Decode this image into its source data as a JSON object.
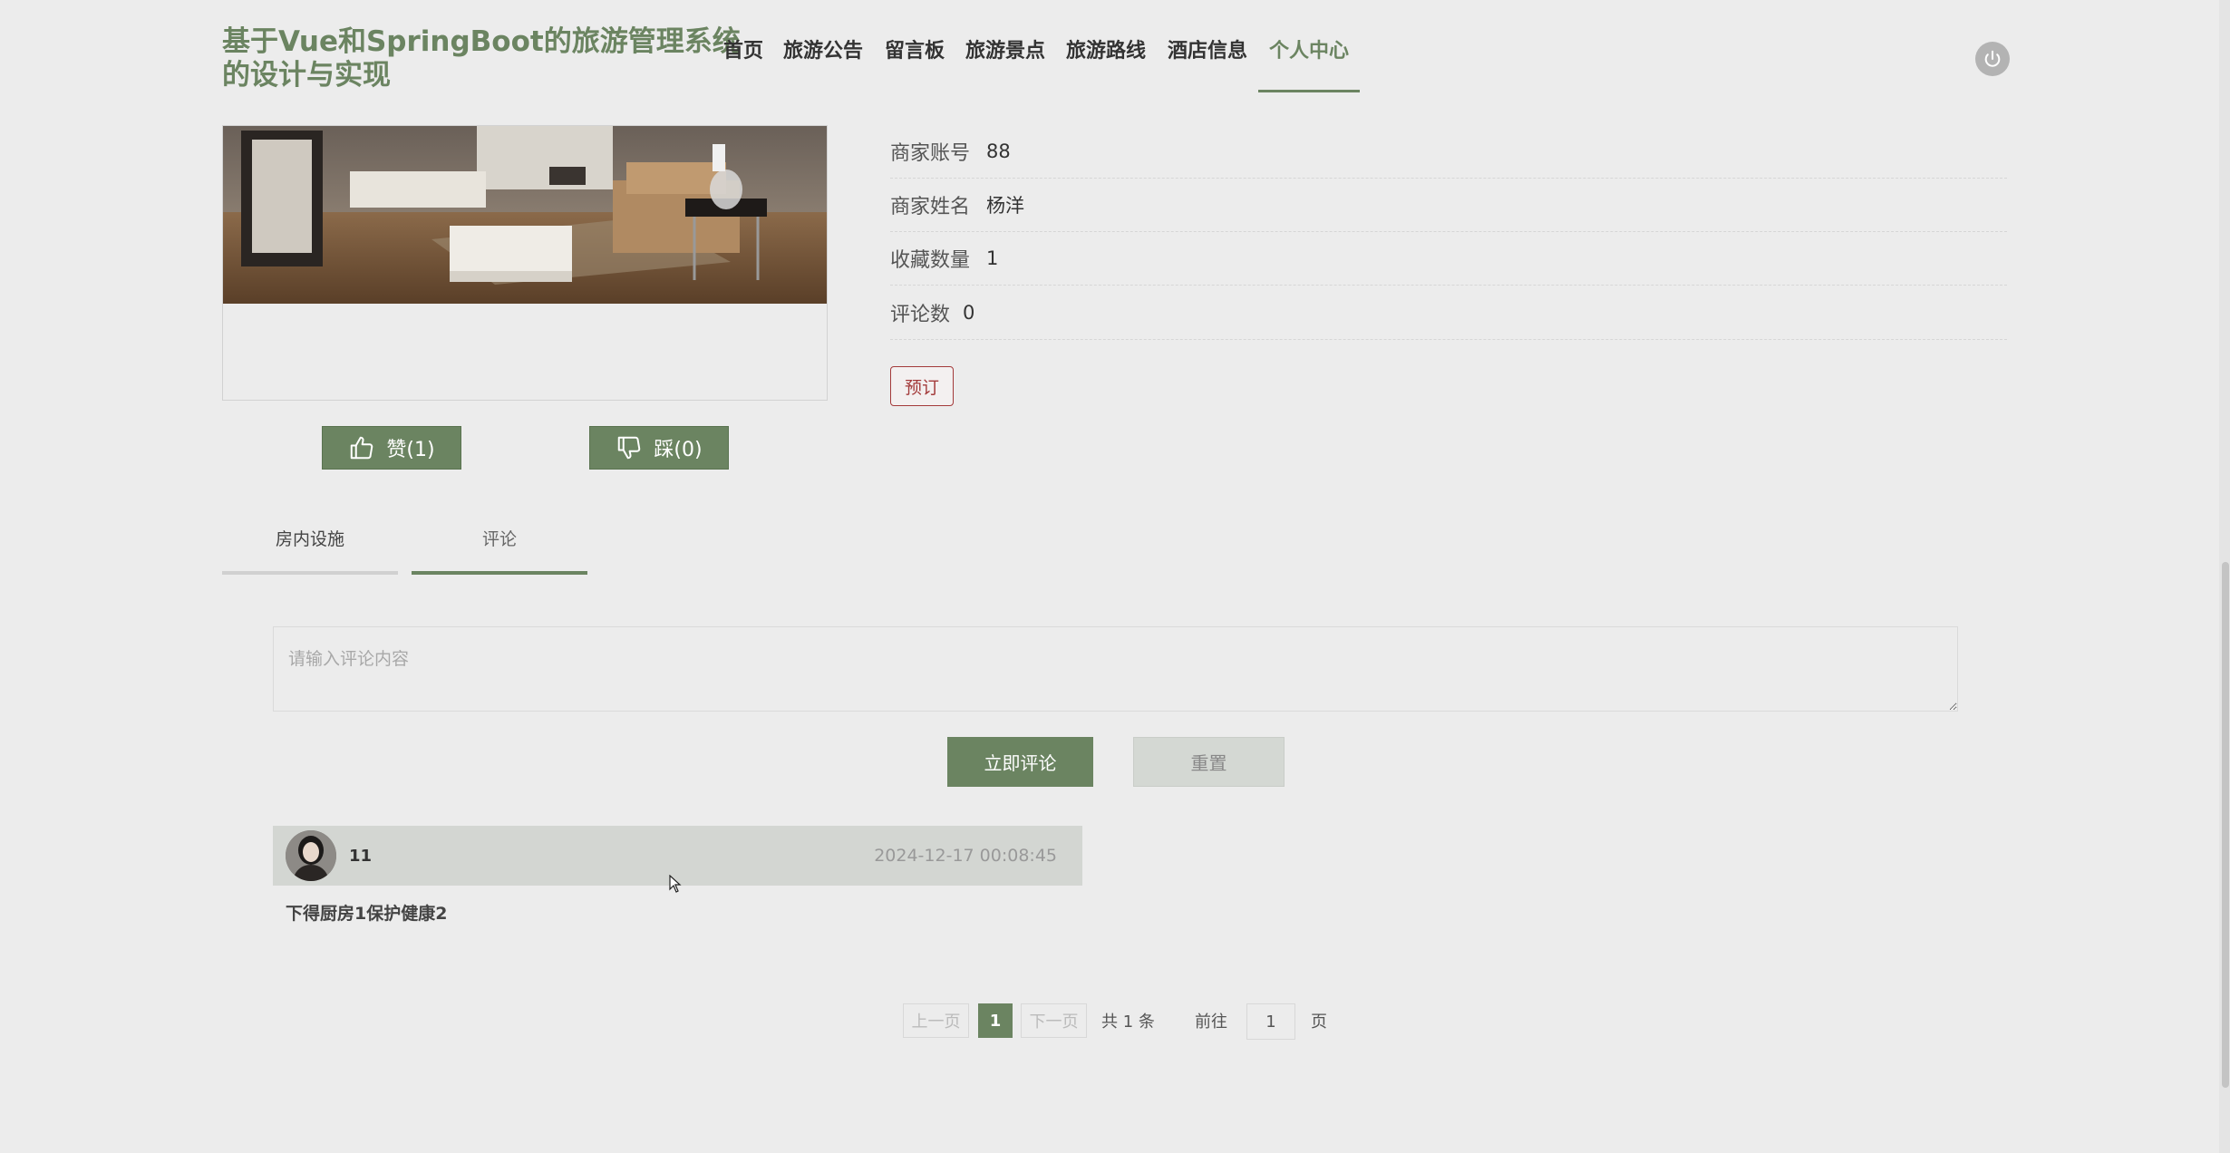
{
  "header": {
    "title": "基于Vue和SpringBoot的旅游管理系统的设计与实现",
    "nav": [
      "首页",
      "旅游公告",
      "留言板",
      "旅游景点",
      "旅游路线",
      "酒店信息",
      "个人中心"
    ],
    "active_nav": "个人中心"
  },
  "votes": {
    "like_label": "赞(1)",
    "dislike_label": "踩(0)"
  },
  "info": [
    {
      "label": "商家账号",
      "value": "88"
    },
    {
      "label": "商家姓名",
      "value": "杨洋"
    },
    {
      "label": "收藏数量",
      "value": "1"
    },
    {
      "label": "评论数",
      "value": "0"
    }
  ],
  "book_label": "预订",
  "tabs": [
    "房内设施",
    "评论"
  ],
  "comment_form": {
    "placeholder": "请输入评论内容",
    "submit_label": "立即评论",
    "reset_label": "重置"
  },
  "comments": [
    {
      "user": "11",
      "time": "2024-12-17 00:08:45",
      "content": "下得厨房1保护健康2"
    }
  ],
  "pagination": {
    "prev": "上一页",
    "current": "1",
    "next": "下一页",
    "total": "共 1 条",
    "goto_label": "前往",
    "goto_value": "1",
    "page_suffix": "页"
  },
  "colors": {
    "accent": "#6b8461",
    "book": "#a33a3a",
    "background": "#ececec"
  }
}
